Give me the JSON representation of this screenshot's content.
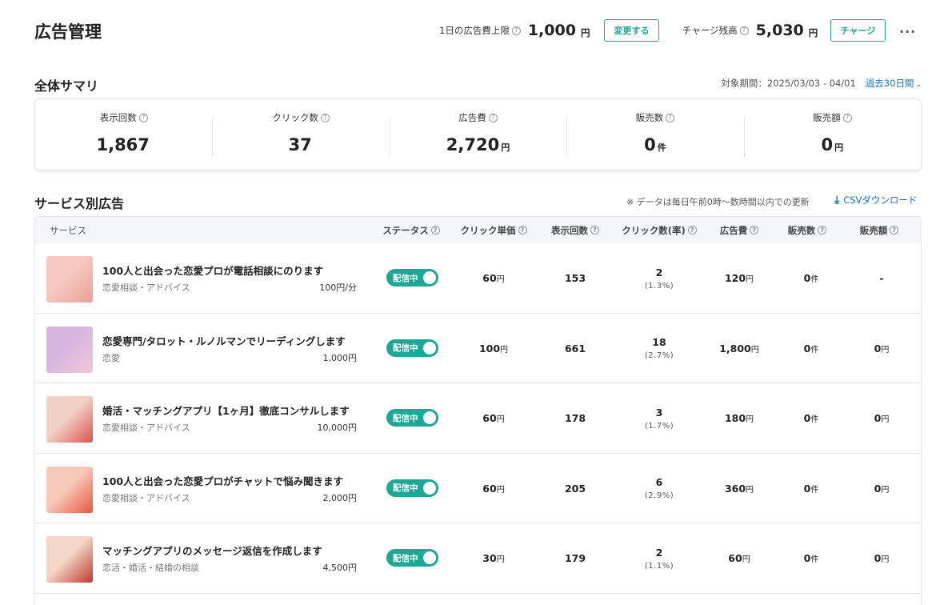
{
  "header": {
    "title": "広告管理",
    "daily_limit_label": "1日の広告費上限",
    "daily_limit_value": "1,000",
    "daily_limit_unit": "円",
    "change_button": "変更する",
    "balance_label": "チャージ残高",
    "balance_value": "5,030",
    "balance_unit": "円",
    "charge_button": "チャージ",
    "more": "···"
  },
  "summary": {
    "title": "全体サマリ",
    "period_label": "対象期間：2025/03/03 - 04/01",
    "period_select": "過去30日間",
    "metrics": [
      {
        "label": "表示回数",
        "value": "1,867",
        "unit": ""
      },
      {
        "label": "クリック数",
        "value": "37",
        "unit": ""
      },
      {
        "label": "広告費",
        "value": "2,720",
        "unit": "円"
      },
      {
        "label": "販売数",
        "value": "0",
        "unit": "件"
      },
      {
        "label": "販売額",
        "value": "0",
        "unit": "円"
      }
    ]
  },
  "services": {
    "title": "サービス別広告",
    "note": "※ データは毎日午前0時～数時間以内での更新",
    "csv_link": "CSVダウンロード",
    "columns": {
      "service": "サービス",
      "status": "ステータス",
      "cpc": "クリック単価",
      "impressions": "表示回数",
      "clicks": "クリック数(率)",
      "cost": "広告費",
      "sales_count": "販売数",
      "sales_amount": "販売額"
    },
    "rows": [
      {
        "title": "100人と出会った恋愛プロが電話相談にのります",
        "category": "恋愛相談・アドバイス",
        "price": "100円/分",
        "status": "配信中",
        "cpc": "60",
        "cpc_unit": "円",
        "impressions": "153",
        "clicks": "2",
        "rate": "(1.3%)",
        "cost": "120",
        "cost_unit": "円",
        "sales_count": "0",
        "sales_count_unit": "件",
        "sales_amount": "-",
        "sales_amount_unit": "",
        "thumb_colors": [
          "#f6c8c0",
          "#e8a093"
        ]
      },
      {
        "title": "恋愛専門/タロット・ルノルマンでリーディングします",
        "category": "恋愛",
        "price": "1,000円",
        "status": "配信中",
        "cpc": "100",
        "cpc_unit": "円",
        "impressions": "661",
        "clicks": "18",
        "rate": "(2.7%)",
        "cost": "1,800",
        "cost_unit": "円",
        "sales_count": "0",
        "sales_count_unit": "件",
        "sales_amount": "0",
        "sales_amount_unit": "円",
        "thumb_colors": [
          "#d8b6e0",
          "#f1c7d8"
        ]
      },
      {
        "title": "婚活・マッチングアプリ【1ヶ月】徹底コンサルします",
        "category": "恋愛相談・アドバイス",
        "price": "10,000円",
        "status": "配信中",
        "cpc": "60",
        "cpc_unit": "円",
        "impressions": "178",
        "clicks": "3",
        "rate": "(1.7%)",
        "cost": "180",
        "cost_unit": "円",
        "sales_count": "0",
        "sales_count_unit": "件",
        "sales_amount": "0",
        "sales_amount_unit": "円",
        "thumb_colors": [
          "#f3d2c6",
          "#d9534f"
        ]
      },
      {
        "title": "100人と出会った恋愛プロがチャットで悩み聞きます",
        "category": "恋愛相談・アドバイス",
        "price": "2,000円",
        "status": "配信中",
        "cpc": "60",
        "cpc_unit": "円",
        "impressions": "205",
        "clicks": "6",
        "rate": "(2.9%)",
        "cost": "360",
        "cost_unit": "円",
        "sales_count": "0",
        "sales_count_unit": "件",
        "sales_amount": "0",
        "sales_amount_unit": "円",
        "thumb_colors": [
          "#f7c9b8",
          "#e4573d"
        ]
      },
      {
        "title": "マッチングアプリのメッセージ返信を作成します",
        "category": "恋活・婚活・結婚の相談",
        "price": "4,500円",
        "status": "配信中",
        "cpc": "30",
        "cpc_unit": "円",
        "impressions": "179",
        "clicks": "2",
        "rate": "(1.1%)",
        "cost": "60",
        "cost_unit": "円",
        "sales_count": "0",
        "sales_count_unit": "件",
        "sales_amount": "0",
        "sales_amount_unit": "円",
        "thumb_colors": [
          "#f2d7c8",
          "#c0392b"
        ]
      }
    ]
  },
  "colors": {
    "accent": "#1fa795",
    "link": "#1a6fc4"
  }
}
